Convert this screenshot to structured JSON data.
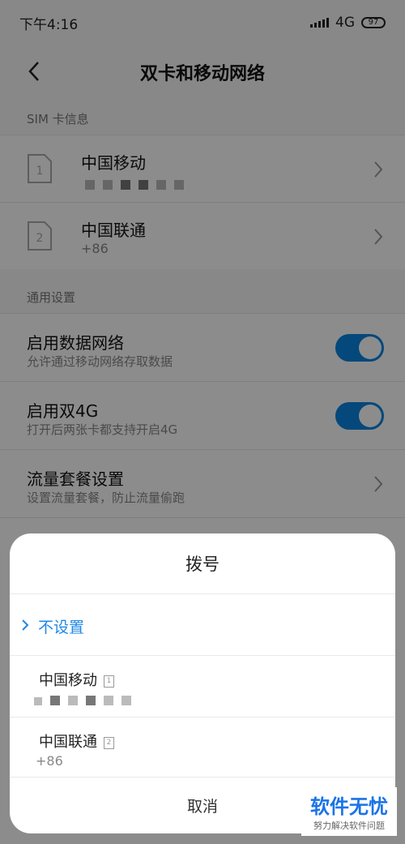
{
  "status": {
    "time": "下午4:16",
    "network": "4G",
    "battery": "97"
  },
  "header": {
    "title": "双卡和移动网络"
  },
  "sim_section": {
    "label": "SIM 卡信息",
    "sims": [
      {
        "slot": "1",
        "carrier": "中国移动"
      },
      {
        "slot": "2",
        "carrier": "中国联通",
        "number": "+86"
      }
    ]
  },
  "general_section": {
    "label": "通用设置",
    "items": [
      {
        "title": "启用数据网络",
        "subtitle": "允许通过移动网络存取数据",
        "toggle_on": true
      },
      {
        "title": "启用双4G",
        "subtitle": "打开后两张卡都支持开启4G",
        "toggle_on": true
      },
      {
        "title": "流量套餐设置",
        "subtitle": "设置流量套餐，防止流量偷跑"
      }
    ]
  },
  "dialog": {
    "title": "拨号",
    "options": [
      {
        "label": "不设置",
        "selected": true
      },
      {
        "label": "中国移动",
        "sim": "1"
      },
      {
        "label": "中国联通",
        "sim": "2",
        "number": "+86"
      }
    ],
    "cancel_label": "取消"
  },
  "watermark": {
    "title": "软件无忧",
    "subtitle": "努力解决软件问题"
  },
  "colors": {
    "accent": "#1e88e5",
    "toggle": "#0a84e0"
  }
}
